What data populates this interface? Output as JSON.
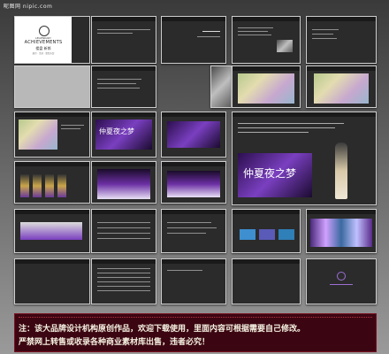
{
  "watermark": "昵图网 nipic.com",
  "cover": {
    "brand_small": "LEGENDARY",
    "brand": "ACHIEVEMENTS",
    "brand_cn": "楼盘 新郎",
    "sub": "展示 · 活动 · 策划方案"
  },
  "slide_title": "仲夏夜之梦",
  "footer": {
    "line1": "注：该大品牌设计机构原创作品，欢迎下载使用，里面内容可根据需要自己修改。",
    "line2": "严禁网上转售或收录各种商业素材库出售，违者必究！"
  },
  "colors": {
    "accent": "#7a3fc0",
    "footer_bg": "#3b0612"
  }
}
